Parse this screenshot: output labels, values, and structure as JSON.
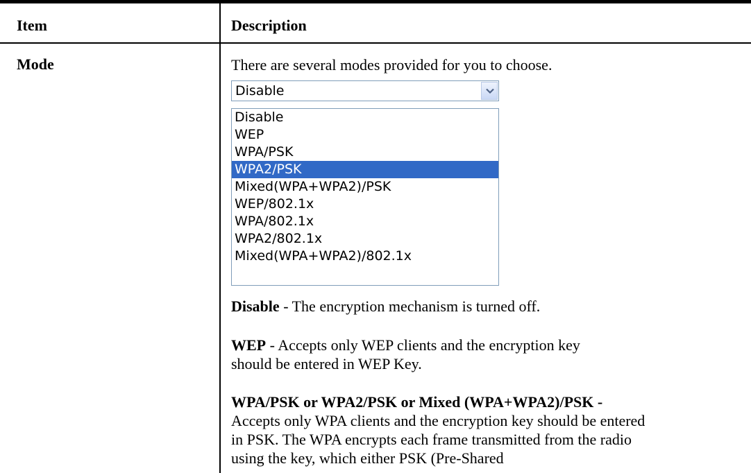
{
  "table": {
    "header": {
      "item": "Item",
      "description": "Description"
    },
    "row": {
      "item": "Mode",
      "intro": "There are several modes provided for you to choose.",
      "select": {
        "value": "Disable",
        "options": [
          "Disable",
          "WEP",
          "WPA/PSK",
          "WPA2/PSK",
          "Mixed(WPA+WPA2)/PSK",
          "WEP/802.1x",
          "WPA/802.1x",
          "WPA2/802.1x",
          "Mixed(WPA+WPA2)/802.1x"
        ],
        "highlighted": "WPA2/PSK"
      },
      "disable": {
        "term": "Disable",
        "text": " - The encryption mechanism is turned off."
      },
      "wep": {
        "term": "WEP",
        "text": " - Accepts only WEP clients and the encryption key should be entered in WEP Key."
      },
      "psk": {
        "term": "WPA/PSK or WPA2/PSK or Mixed (WPA+WPA2)/PSK -",
        "text": "Accepts only WPA clients and the encryption key should be entered in PSK. The WPA encrypts each frame transmitted from the radio using the key, which either PSK (Pre-Shared"
      }
    }
  },
  "colors": {
    "selection": "#3169c6",
    "border": "#7f9db9"
  },
  "icons": {
    "dropdown": "chevron-down-icon"
  }
}
